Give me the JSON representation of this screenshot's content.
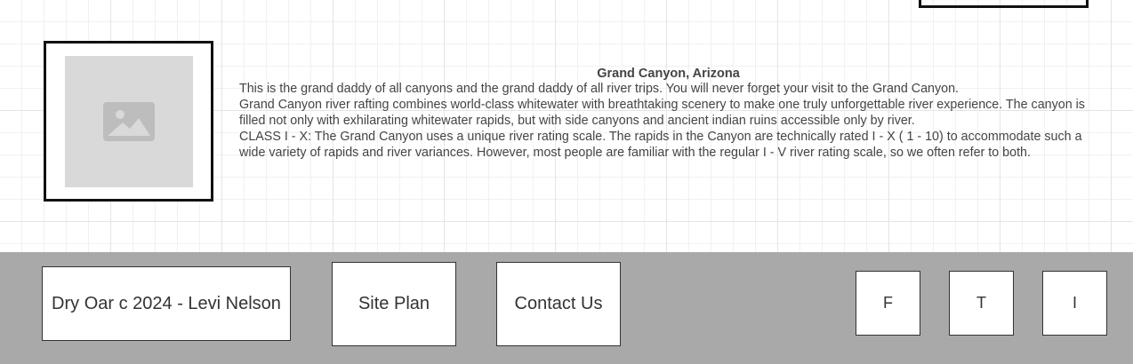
{
  "article": {
    "title": "Grand Canyon, Arizona",
    "paragraphs": [
      "This is the grand daddy of all canyons and the grand daddy of all river trips. You will never forget your visit to the Grand Canyon.",
      "Grand Canyon river rafting combines world-class whitewater with breathtaking scenery to make one truly unforgettable river experience. The canyon is filled not only with exhilarating whitewater rapids, but with side canyons and ancient indian ruins accessible only by river.",
      "CLASS I - X: The Grand Canyon uses a unique river rating scale. The rapids in the Canyon are technically rated I - X ( 1 - 10) to accommodate such a wide variety of rapids and river variances. However, most people are familiar with the regular I - V river rating scale, so we often refer to both."
    ],
    "image_icon": "image-placeholder-icon"
  },
  "footer": {
    "copyright": "Dry Oar c 2024 - Levi Nelson",
    "site_plan": "Site Plan",
    "contact": "Contact Us",
    "social": {
      "facebook": "F",
      "twitter": "T",
      "instagram": "I"
    }
  },
  "colors": {
    "footer_bg": "#a9a9a9",
    "placeholder_bg": "#d9d9d9",
    "placeholder_icon": "#bdbdbd"
  }
}
